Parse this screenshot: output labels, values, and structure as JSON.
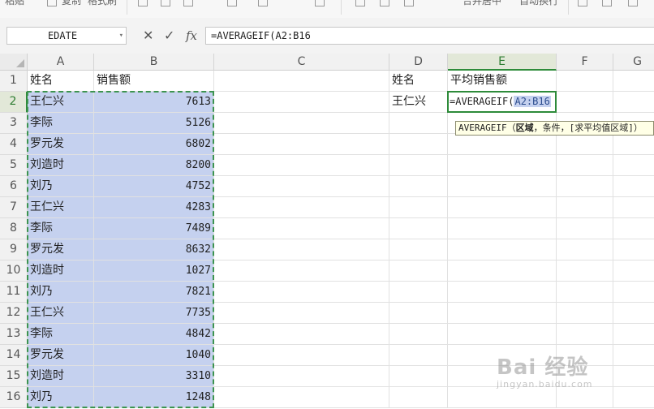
{
  "ribbon": {
    "items": [
      "粘贴",
      "复制",
      "格式刷",
      "合并居中",
      "自动换行"
    ]
  },
  "formula_bar": {
    "name_box": "EDATE",
    "cancel_icon": "✕",
    "confirm_icon": "✓",
    "fx_label": "fx",
    "formula": "=AVERAGEIF(A2:B16"
  },
  "columns": [
    "A",
    "B",
    "C",
    "D",
    "E",
    "F",
    "G"
  ],
  "rows": [
    "1",
    "2",
    "3",
    "4",
    "5",
    "6",
    "7",
    "8",
    "9",
    "10",
    "11",
    "12",
    "13",
    "14",
    "15",
    "16"
  ],
  "active": {
    "column": "E",
    "row": "2"
  },
  "sheet": {
    "a1": "姓名",
    "b1": "销售额",
    "d1": "姓名",
    "e1": "平均销售额",
    "d2": "王仁兴",
    "data": [
      {
        "name": "王仁兴",
        "sales": "7613"
      },
      {
        "name": "李际",
        "sales": "5126"
      },
      {
        "name": "罗元发",
        "sales": "6802"
      },
      {
        "name": "刘造时",
        "sales": "8200"
      },
      {
        "name": "刘乃",
        "sales": "4752"
      },
      {
        "name": "王仁兴",
        "sales": "4283"
      },
      {
        "name": "李际",
        "sales": "7489"
      },
      {
        "name": "罗元发",
        "sales": "8632"
      },
      {
        "name": "刘造时",
        "sales": "1027"
      },
      {
        "name": "刘乃",
        "sales": "7821"
      },
      {
        "name": "王仁兴",
        "sales": "7735"
      },
      {
        "name": "李际",
        "sales": "4842"
      },
      {
        "name": "罗元发",
        "sales": "1040"
      },
      {
        "name": "刘造时",
        "sales": "3310"
      },
      {
        "name": "刘乃",
        "sales": "1248"
      }
    ]
  },
  "editing": {
    "prefix": "=AVERAGEIF(",
    "range_ref": "A2:B16"
  },
  "tooltip": {
    "fn": "AVERAGEIF",
    "open": "（",
    "arg1": "区域",
    "rest": "，条件，[求平均值区域]）"
  },
  "watermark": {
    "brand": "Bai 经验",
    "sub": "jingyan.baidu.com"
  },
  "colors": {
    "selection_fill": "#c5d1ef",
    "accent_green": "#2e8b3a",
    "tooltip_bg": "#ffffe6"
  }
}
